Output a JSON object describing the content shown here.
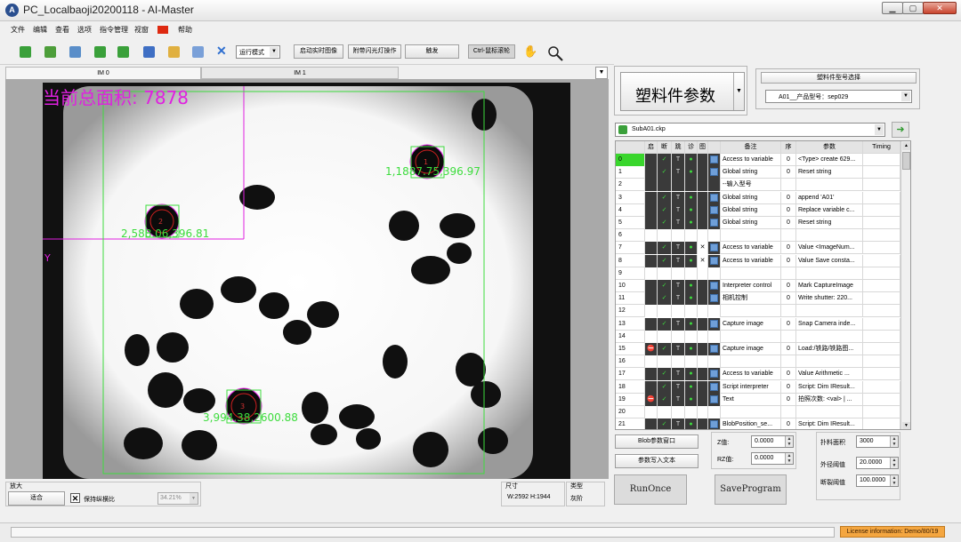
{
  "app": {
    "icon_letter": "A",
    "title": "PC_Localbaoji20200118 - AI-Master"
  },
  "window_controls": {
    "minimize": "▁",
    "maximize": "▢",
    "close": "✕"
  },
  "menu": [
    "文件",
    "编辑",
    "查看",
    "选项",
    "指令管理",
    "视窗",
    "帮助"
  ],
  "toolbar": {
    "mode_select": "运行模式",
    "realtime_btn": "启动实时图像",
    "flash_btn": "附带闪光灯操作",
    "trigger_btn": "触发",
    "ctrl_wheel_btn": "Ctrl-鼠标滚轮"
  },
  "tabs": [
    "IM 0",
    "IM 1"
  ],
  "tab_menu_arrow": "▼",
  "image": {
    "overlay_text": "当前总面积: 7878",
    "y_axis_label": "Y",
    "labels": [
      {
        "text": "1,1887.75,396.97"
      },
      {
        "text": "2,588.06,396.81"
      },
      {
        "text": "3,994.38,2600.88"
      }
    ],
    "marker_numbers": [
      "1",
      "2",
      "3"
    ]
  },
  "bottom": {
    "zoom_group": "放大",
    "fit_btn": "适合",
    "keep_ratio": "保持纵横比",
    "keep_ratio_mark": "✕",
    "zoom_value": "34.21%",
    "size_group": "尺寸",
    "size_value": "W:2592  H:1944",
    "type_group": "类型",
    "type_value": "灰阶"
  },
  "right": {
    "param_btn": "塑料件参数",
    "model_group": "塑料件型号选择",
    "model_select": "A01__产品型号：sep029",
    "sub_select": "SubA01.ckp",
    "columns": [
      "",
      "启",
      "断",
      "跳",
      "诊",
      "图",
      "",
      "备注",
      "序",
      "参数",
      "Timing"
    ],
    "rows": [
      {
        "n": "0",
        "name": "Access to variable",
        "seq": "0",
        "param": "<Type> create 629..."
      },
      {
        "n": "1",
        "name": "Global string",
        "seq": "0",
        "param": "Reset string"
      },
      {
        "n": "2",
        "name": "--输入型号",
        "seq": "",
        "param": ""
      },
      {
        "n": "3",
        "name": "Global string",
        "seq": "0",
        "param": "append 'A01'"
      },
      {
        "n": "4",
        "name": "Global string",
        "seq": "0",
        "param": "Replace variable c..."
      },
      {
        "n": "5",
        "name": "Global string",
        "seq": "0",
        "param": "Reset string"
      },
      {
        "n": "6",
        "name": "",
        "seq": "",
        "param": ""
      },
      {
        "n": "7",
        "name": "Access to variable",
        "seq": "0",
        "param": "Value <ImageNum..."
      },
      {
        "n": "8",
        "name": "Access to variable",
        "seq": "0",
        "param": "Value Save consta..."
      },
      {
        "n": "9",
        "name": "",
        "seq": "",
        "param": ""
      },
      {
        "n": "10",
        "name": "Interpreter control",
        "seq": "0",
        "param": "Mark CaptureImage"
      },
      {
        "n": "11",
        "name": "相机控制",
        "seq": "0",
        "param": "Write shutter: 220..."
      },
      {
        "n": "12",
        "name": "",
        "seq": "",
        "param": ""
      },
      {
        "n": "13",
        "name": "Capture image",
        "seq": "0",
        "param": "Snap Camera inde..."
      },
      {
        "n": "14",
        "name": "",
        "seq": "",
        "param": ""
      },
      {
        "n": "15",
        "name": "Capture image",
        "seq": "0",
        "param": "Load:/铁路/铁路图..."
      },
      {
        "n": "16",
        "name": "",
        "seq": "",
        "param": ""
      },
      {
        "n": "17",
        "name": "Access to variable",
        "seq": "0",
        "param": "Value  Arithmetic ..."
      },
      {
        "n": "18",
        "name": "Script interpreter",
        "seq": "0",
        "param": "Script: Dim IResult..."
      },
      {
        "n": "19",
        "name": "Text",
        "seq": "0",
        "param": "拍照次数: <val> | ..."
      },
      {
        "n": "20",
        "name": "",
        "seq": "",
        "param": ""
      },
      {
        "n": "21",
        "name": "BlobPosition_se...",
        "seq": "0",
        "param": "Script: Dim IResult..."
      }
    ],
    "blob_window_btn": "Blob参数窗口",
    "write_params_btn": "参数写入文本",
    "z_label": "Z值:",
    "z_value": "0.0000",
    "rz_label": "RZ值:",
    "rz_value": "0.0000",
    "area_label": "扑料面积",
    "area_value": "3000",
    "outer_label": "外径阈值",
    "outer_value": "20.0000",
    "break_label": "断裂阈值",
    "break_value": "100.0000",
    "run_once_btn": "RunOnce",
    "save_program_btn": "SaveProgram"
  },
  "status": {
    "license": "License information: Demo/80/19"
  },
  "colors": {
    "green_overlay": "#3ddc3d",
    "magenta_overlay": "#e020e0",
    "license_bg": "#f4a640",
    "selected_row": "#39d62c"
  }
}
